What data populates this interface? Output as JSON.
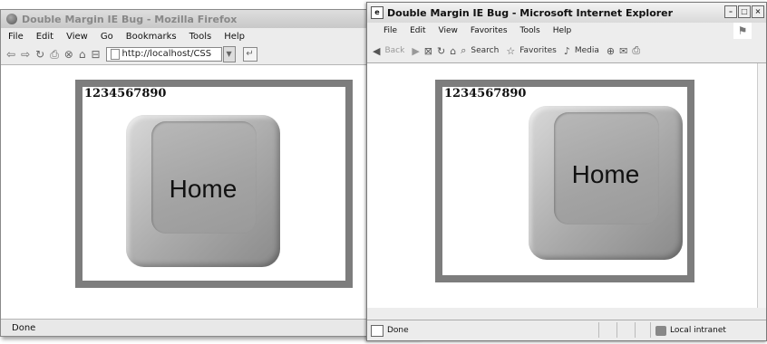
{
  "firefox": {
    "title": "Double Margin IE Bug - Mozilla Firefox",
    "menu": [
      "File",
      "Edit",
      "View",
      "Go",
      "Bookmarks",
      "Tools",
      "Help"
    ],
    "url": "http://localhost/CSS",
    "status": "Done"
  },
  "ie": {
    "title": "Double Margin IE Bug - Microsoft Internet Explorer",
    "menu": [
      "File",
      "Edit",
      "View",
      "Favorites",
      "Tools",
      "Help"
    ],
    "toolbar": {
      "back": "Back",
      "search": "Search",
      "favorites": "Favorites",
      "media": "Media"
    },
    "status": "Done",
    "zone": "Local intranet"
  },
  "page": {
    "digits": "1234567890",
    "key_label": "Home"
  }
}
